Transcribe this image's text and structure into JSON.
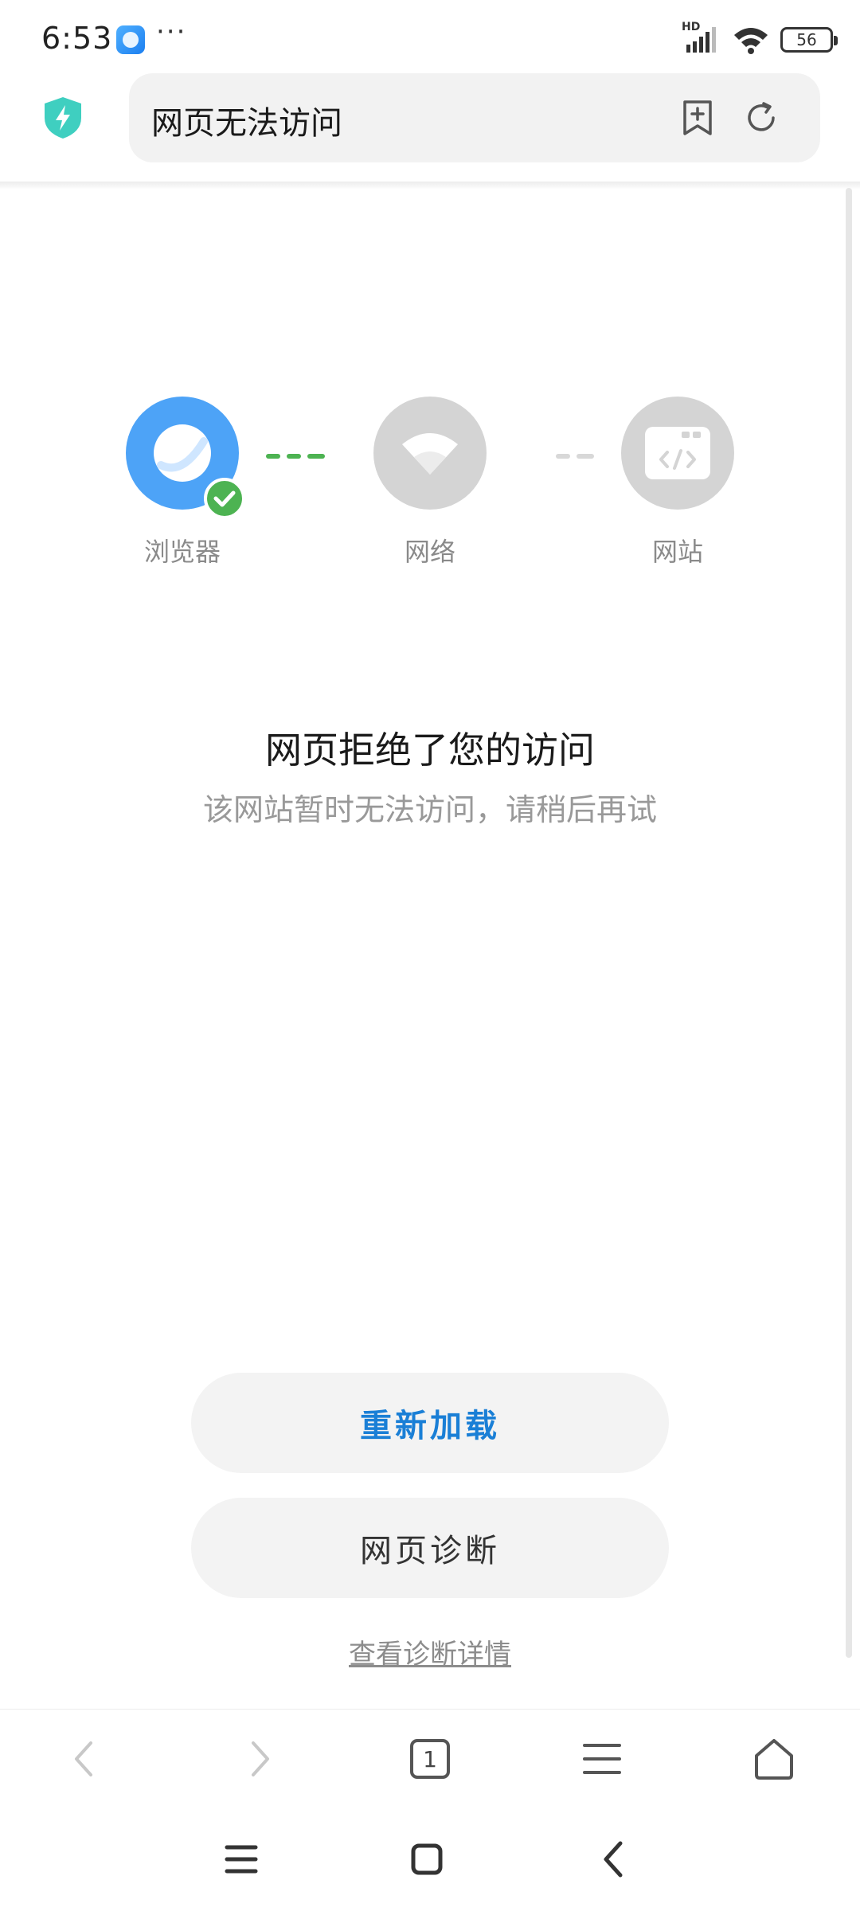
{
  "status_bar": {
    "time": "6:53",
    "more": "···",
    "network_badge": "HD",
    "battery_level": "56"
  },
  "address_bar": {
    "title": "网页无法访问"
  },
  "diagnosis": {
    "nodes": [
      {
        "label": "浏览器",
        "status": "ok"
      },
      {
        "label": "网络",
        "status": "pending"
      },
      {
        "label": "网站",
        "status": "pending"
      }
    ]
  },
  "error": {
    "title": "网页拒绝了您的访问",
    "subtitle": "该网站暂时无法访问，请稍后再试"
  },
  "actions": {
    "reload_label": "重新加载",
    "diagnose_label": "网页诊断",
    "details_link": "查看诊断详情"
  },
  "toolbar": {
    "tab_count": "1"
  },
  "colors": {
    "accent": "#1a7fd6",
    "browser_node": "#4da3f7",
    "ok": "#4db352",
    "inactive": "#d4d4d4",
    "shield": "#3fcfc0"
  }
}
